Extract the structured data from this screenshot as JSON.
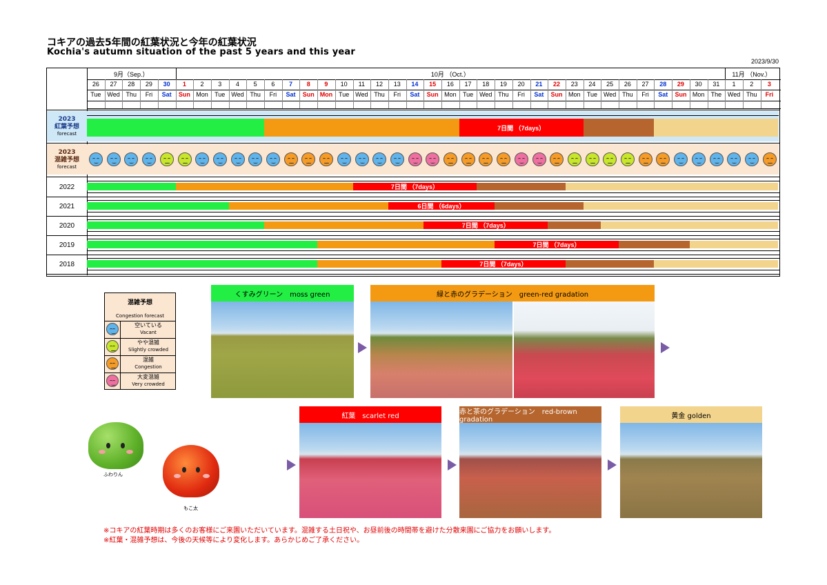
{
  "title_jp": "コキアの過去5年間の紅葉状況と今年の紅葉状況",
  "title_en": "Kochia's autumn situation of the past 5 years and this year",
  "date": "2023/9/30",
  "months": [
    {
      "label": "9月（Sep.）",
      "days": 5
    },
    {
      "label": "10月 （Oct.）",
      "days": 31
    },
    {
      "label": "11月 （Nov.）",
      "days": 3
    }
  ],
  "days": [
    {
      "d": "26",
      "w": "Tue",
      "c": "n"
    },
    {
      "d": "27",
      "w": "Wed",
      "c": "n"
    },
    {
      "d": "28",
      "w": "Thu",
      "c": "n"
    },
    {
      "d": "29",
      "w": "Fri",
      "c": "n"
    },
    {
      "d": "30",
      "w": "Sat",
      "c": "b"
    },
    {
      "d": "1",
      "w": "Sun",
      "c": "r"
    },
    {
      "d": "2",
      "w": "Mon",
      "c": "n"
    },
    {
      "d": "3",
      "w": "Tue",
      "c": "n"
    },
    {
      "d": "4",
      "w": "Wed",
      "c": "n"
    },
    {
      "d": "5",
      "w": "Thu",
      "c": "n"
    },
    {
      "d": "6",
      "w": "Fri",
      "c": "n"
    },
    {
      "d": "7",
      "w": "Sat",
      "c": "b"
    },
    {
      "d": "8",
      "w": "Sun",
      "c": "r"
    },
    {
      "d": "9",
      "w": "Mon",
      "c": "r"
    },
    {
      "d": "10",
      "w": "Tue",
      "c": "n"
    },
    {
      "d": "11",
      "w": "Wed",
      "c": "n"
    },
    {
      "d": "12",
      "w": "Thu",
      "c": "n"
    },
    {
      "d": "13",
      "w": "Fri",
      "c": "n"
    },
    {
      "d": "14",
      "w": "Sat",
      "c": "b"
    },
    {
      "d": "15",
      "w": "Sun",
      "c": "r"
    },
    {
      "d": "16",
      "w": "Mon",
      "c": "n"
    },
    {
      "d": "17",
      "w": "Tue",
      "c": "n"
    },
    {
      "d": "18",
      "w": "Wed",
      "c": "n"
    },
    {
      "d": "19",
      "w": "Thu",
      "c": "n"
    },
    {
      "d": "20",
      "w": "Fri",
      "c": "n"
    },
    {
      "d": "21",
      "w": "Sat",
      "c": "b"
    },
    {
      "d": "22",
      "w": "Sun",
      "c": "r"
    },
    {
      "d": "23",
      "w": "Mon",
      "c": "n"
    },
    {
      "d": "24",
      "w": "Tue",
      "c": "n"
    },
    {
      "d": "25",
      "w": "Wed",
      "c": "n"
    },
    {
      "d": "26",
      "w": "Thu",
      "c": "n"
    },
    {
      "d": "27",
      "w": "Fri",
      "c": "n"
    },
    {
      "d": "28",
      "w": "Sat",
      "c": "b"
    },
    {
      "d": "29",
      "w": "Sun",
      "c": "r"
    },
    {
      "d": "30",
      "w": "Mon",
      "c": "n"
    },
    {
      "d": "31",
      "w": "The",
      "c": "n"
    },
    {
      "d": "1",
      "w": "Wed",
      "c": "n"
    },
    {
      "d": "2",
      "w": "Thu",
      "c": "n"
    },
    {
      "d": "3",
      "w": "Fri",
      "c": "r"
    }
  ],
  "forecast_label": {
    "jp": "2023\n紅葉予想",
    "en": "forecast"
  },
  "congestion_label": {
    "jp": "2023\n混雑予想",
    "en": "forecast"
  },
  "colors": {
    "green": "#22ee44",
    "orange": "#f39a12",
    "red": "#ff0000",
    "brown": "#b5652d",
    "golden": "#f2d48c",
    "vacant": "#5fb4ec",
    "slight": "#c8e62a",
    "congestion": "#f59b26",
    "very": "#ef6fa0"
  },
  "forecast_2023": [
    {
      "start": 0,
      "end": 10,
      "color": "green",
      "text": ""
    },
    {
      "start": 10,
      "end": 21,
      "color": "orange",
      "text": ""
    },
    {
      "start": 21,
      "end": 28,
      "color": "red",
      "text": "7日間 （7days）"
    },
    {
      "start": 28,
      "end": 32,
      "color": "brown",
      "text": ""
    },
    {
      "start": 32,
      "end": 39,
      "color": "golden",
      "text": ""
    }
  ],
  "congestion_2023": [
    "v",
    "v",
    "v",
    "v",
    "s",
    "s",
    "v",
    "v",
    "v",
    "v",
    "v",
    "c",
    "c",
    "c",
    "v",
    "v",
    "v",
    "v",
    "x",
    "x",
    "c",
    "c",
    "c",
    "c",
    "x",
    "x",
    "c",
    "s",
    "s",
    "s",
    "s",
    "c",
    "c",
    "v",
    "v",
    "v",
    "v",
    "v",
    "c"
  ],
  "years": [
    {
      "year": "2022",
      "segments": [
        {
          "start": 0,
          "end": 5,
          "color": "green",
          "text": ""
        },
        {
          "start": 5,
          "end": 15,
          "color": "orange",
          "text": ""
        },
        {
          "start": 15,
          "end": 22,
          "color": "red",
          "text": "7日間 （7days）"
        },
        {
          "start": 22,
          "end": 27,
          "color": "brown",
          "text": ""
        },
        {
          "start": 27,
          "end": 39,
          "color": "golden",
          "text": ""
        }
      ]
    },
    {
      "year": "2021",
      "segments": [
        {
          "start": 0,
          "end": 8,
          "color": "green",
          "text": ""
        },
        {
          "start": 8,
          "end": 17,
          "color": "orange",
          "text": ""
        },
        {
          "start": 17,
          "end": 23,
          "color": "red",
          "text": "6日間 （6days）"
        },
        {
          "start": 23,
          "end": 28,
          "color": "brown",
          "text": ""
        },
        {
          "start": 28,
          "end": 39,
          "color": "golden",
          "text": ""
        }
      ]
    },
    {
      "year": "2020",
      "segments": [
        {
          "start": 0,
          "end": 10,
          "color": "green",
          "text": ""
        },
        {
          "start": 10,
          "end": 19,
          "color": "orange",
          "text": ""
        },
        {
          "start": 19,
          "end": 26,
          "color": "red",
          "text": "7日間 （7days）"
        },
        {
          "start": 26,
          "end": 29,
          "color": "brown",
          "text": ""
        },
        {
          "start": 29,
          "end": 39,
          "color": "golden",
          "text": ""
        }
      ]
    },
    {
      "year": "2019",
      "segments": [
        {
          "start": 0,
          "end": 13,
          "color": "green",
          "text": ""
        },
        {
          "start": 13,
          "end": 23,
          "color": "orange",
          "text": ""
        },
        {
          "start": 23,
          "end": 30,
          "color": "red",
          "text": "7日間 （7days）"
        },
        {
          "start": 30,
          "end": 34,
          "color": "brown",
          "text": ""
        },
        {
          "start": 34,
          "end": 39,
          "color": "golden",
          "text": ""
        }
      ]
    },
    {
      "year": "2018",
      "segments": [
        {
          "start": 0,
          "end": 13,
          "color": "green",
          "text": ""
        },
        {
          "start": 13,
          "end": 20,
          "color": "orange",
          "text": ""
        },
        {
          "start": 20,
          "end": 27,
          "color": "red",
          "text": "7日間 （7days）"
        },
        {
          "start": 27,
          "end": 32,
          "color": "brown",
          "text": ""
        },
        {
          "start": 32,
          "end": 39,
          "color": "golden",
          "text": ""
        }
      ]
    }
  ],
  "legend": {
    "title": "混雑予想",
    "subtitle": "Congestion forecast",
    "items": [
      {
        "jp": "空いている",
        "en": "Vacant"
      },
      {
        "jp": "やや混雑",
        "en": "Slightly crowded"
      },
      {
        "jp": "混雑",
        "en": "Congestion"
      },
      {
        "jp": "大変混雑",
        "en": "Very crowded"
      }
    ]
  },
  "stages": {
    "moss": "くすみグリーン　moss green",
    "greenred": "緑と赤のグラデーション　green-red gradation",
    "scarlet": "紅葉　scarlet red",
    "redbrown": "赤と茶のグラデーション　red-brown gradation",
    "golden": "黄金 golden"
  },
  "mascots": {
    "green": "ふわりん",
    "red": "もこ太"
  },
  "notes": [
    "※コキアの紅葉時期は多くのお客様にご来園いただいています。混雑する土日祝や、お昼前後の時間帯を避けた分散来園にご協力をお願いします。",
    "※紅葉・混雑予想は、今後の天候等により変化します。あらかじめご了承ください。"
  ]
}
